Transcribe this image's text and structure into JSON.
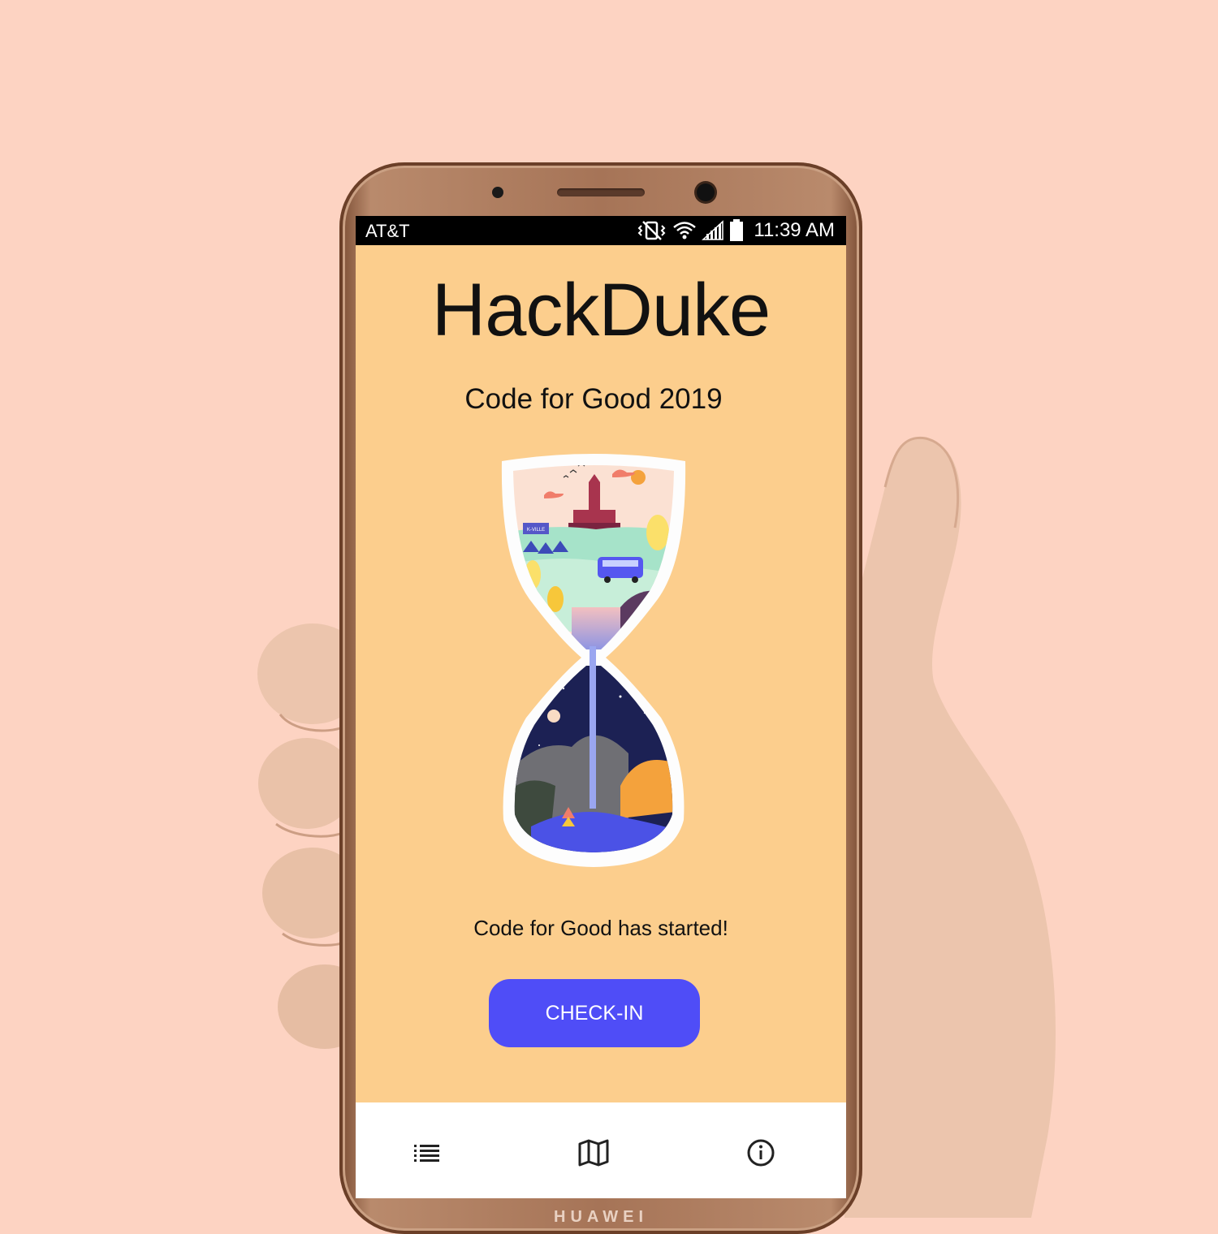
{
  "statusbar": {
    "carrier": "AT&T",
    "time": "11:39 AM",
    "icons": [
      "mute-vibrate-icon",
      "wifi-icon",
      "signal-icon",
      "battery-icon"
    ]
  },
  "app": {
    "title": "HackDuke",
    "subtitle": "Code for Good 2019",
    "illustration": "hourglass-illustration",
    "illustration_sign": "K-VILLE",
    "message": "Code for Good has started!",
    "checkin_label": "CHECK-IN",
    "accent": "#4f4df7",
    "background": "#fcce8d"
  },
  "navbar": {
    "items": [
      {
        "icon": "list-icon"
      },
      {
        "icon": "map-icon"
      },
      {
        "icon": "info-icon"
      }
    ]
  },
  "device": {
    "brand": "HUAWEI"
  }
}
